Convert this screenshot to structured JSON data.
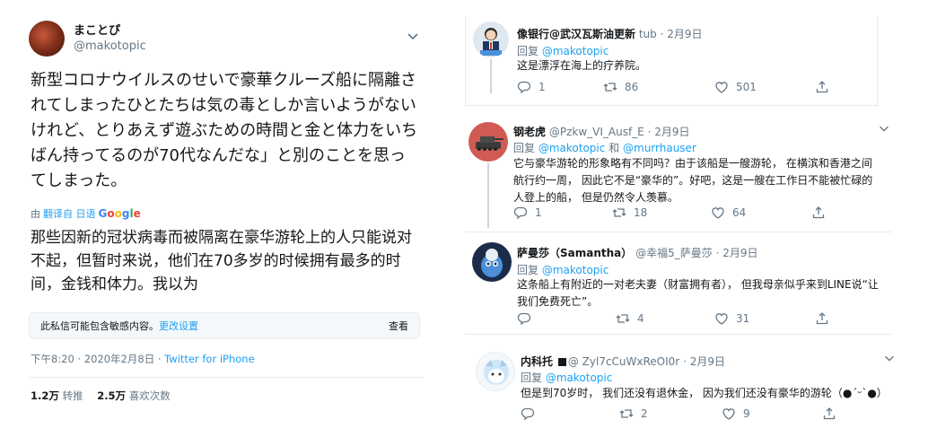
{
  "main_tweet": {
    "display_name": "まことぴ",
    "handle": "@makotopic",
    "text_ja": "新型コロナウイルスのせいで豪華クルーズ船に隔離されてしまったひとたちは気の毒としか言いようがないけれど、とりあえず遊ぶための時間と金と体力をいちばん持ってるのが70代なんだな」と別のことを思ってしまった。",
    "translated_by": "由",
    "translated_link": "翻译自 日语",
    "google": [
      "G",
      "o",
      "o",
      "g",
      "l",
      "e"
    ],
    "text_zh": "那些因新的冠状病毒而被隔离在豪华游轮上的人只能说对不起，但暂时来说，他们在70多岁的时候拥有最多的时间，金钱和体力。我以为",
    "sensitive_text": "此私信可能包含敏感内容。",
    "sensitive_link": "更改设置",
    "sensitive_view": "查看",
    "timestamp": "下午8:20 · 2020年2月8日 · ",
    "source": "Twitter for iPhone",
    "retweets_count": "1.2万",
    "retweets_label": "转推",
    "likes_count": "2.5万",
    "likes_label": "喜欢次数"
  },
  "replies": [
    {
      "display_name": "像银行@武汉瓦斯油更新",
      "handle": "tub",
      "date": "· 2月9日",
      "reply_prefix": "回复",
      "reply_to": "@makotopic",
      "reply_to_2": "",
      "text": "这是漂浮在海上的疗养院。",
      "replies": "1",
      "retweets": "86",
      "likes": "501"
    },
    {
      "display_name": "钢老虎",
      "handle": "@Pzkw_VI_Ausf_E",
      "date": "· 2月9日",
      "reply_prefix": "回复",
      "reply_to": "@makotopic",
      "reply_and": " 和 ",
      "reply_to_2": "@murrhauser",
      "text": "它与豪华游轮的形象略有不同吗？由于该船是一艘游轮， 在横滨和香港之间航行约一周， 因此它不是“豪华的”。好吧，这是一艘在工作日不能被忙碌的人登上的船， 但是仍然令人羡慕。",
      "replies": "1",
      "retweets": "18",
      "likes": "64"
    },
    {
      "display_name": "萨曼莎（Samantha）",
      "handle": "@幸福5_萨曼莎",
      "date": "· 2月9日",
      "reply_prefix": "回复",
      "reply_to": "@makotopic",
      "text": "这条船上有附近的一对老夫妻（财富拥有者）， 但我母亲似乎来到LINE说“让我们免费死亡”。",
      "replies": "",
      "retweets": "4",
      "likes": "31"
    },
    {
      "display_name": "内科托",
      "handle": "@ Zyl7cCuWxReOI0r",
      "date": "· 2月9日",
      "reply_prefix": "回复",
      "reply_to": "@makotopic",
      "text": "但是到70岁时， 我们还没有退休金， 因为我们还没有豪华的游轮（●´ᵕ`●）",
      "replies": "",
      "retweets": "2",
      "likes": "9"
    }
  ],
  "colors": {
    "link": "#1da1f2",
    "muted": "#657786",
    "border": "#e6ecf0"
  }
}
